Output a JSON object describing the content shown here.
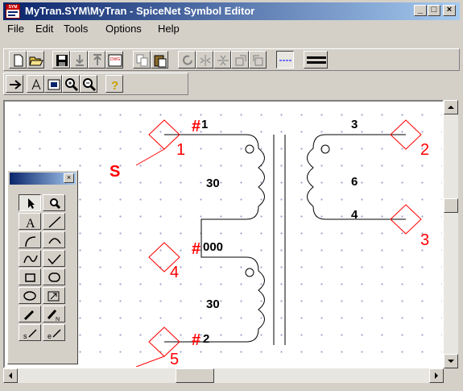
{
  "window": {
    "title": "MyTran.SYM\\MyTran - SpiceNet Symbol Editor",
    "icon_text": "SYM",
    "minimize": "_",
    "maximize": "□",
    "close": "×"
  },
  "menu": [
    "File",
    "Edit",
    "Tools",
    "Options",
    "Help"
  ],
  "toolbar1": [
    "new-icon",
    "open-icon",
    "save-icon",
    "import-icon",
    "export-icon",
    "dwg-icon",
    "copy-icon",
    "paste-icon",
    "rotate-icon",
    "flip-horizontal-icon",
    "flip-vertical-icon",
    "align-icon",
    "align-right-icon",
    "line-style-icon",
    "line-thick-icon"
  ],
  "toolbar1_dwg_text": "DWG",
  "toolbar2": [
    "arrow-icon",
    "text-style-icon",
    "fill-icon",
    "zoom-in-icon",
    "zoom-out-icon",
    "help-icon"
  ],
  "help_glyph": "?",
  "palette": {
    "close_label": "×",
    "text_glyph": "A",
    "start_label": "s",
    "end_label": "e",
    "end_node_label": "N",
    "tools": [
      "select-arrow",
      "zoom",
      "text",
      "line",
      "arc-left",
      "arc-right",
      "wave",
      "check-line",
      "rectangle",
      "rounded-rect",
      "ellipse",
      "pin",
      "line-end",
      "node-end",
      "start",
      "end"
    ]
  },
  "schematic": {
    "marker_label": "S",
    "pin_marker": "#",
    "pins": [
      {
        "num": "1",
        "label": "1"
      },
      {
        "num": "2",
        "label": "3"
      },
      {
        "num": "3",
        "label": "4"
      },
      {
        "num": "4",
        "label": "000"
      },
      {
        "num": "5",
        "label": "2"
      }
    ],
    "turns": {
      "primary_top": "30",
      "primary_bottom": "30",
      "secondary": "6"
    }
  },
  "colors": {
    "title_start": "#0a246a",
    "title_end": "#a6caf0",
    "pin_red": "#ff0000",
    "face": "#d4d0c8",
    "grid_dot": "#9aa3c8"
  }
}
